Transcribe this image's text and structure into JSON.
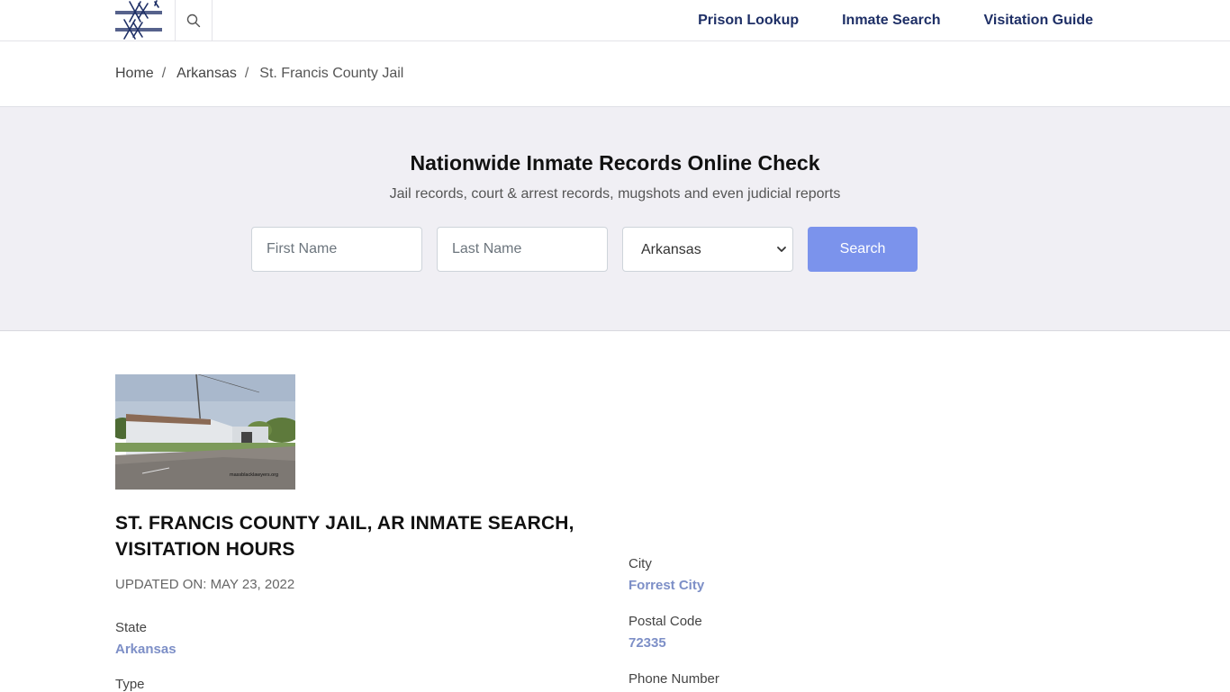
{
  "header": {
    "nav": [
      {
        "label": "Prison Lookup"
      },
      {
        "label": "Inmate Search"
      },
      {
        "label": "Visitation Guide"
      }
    ]
  },
  "breadcrumb": {
    "home": "Home",
    "state": "Arkansas",
    "current": "St. Francis County Jail",
    "separator": "/"
  },
  "hero": {
    "title": "Nationwide Inmate Records Online Check",
    "subtitle": "Jail records, court & arrest records, mugshots and even judicial reports",
    "first_name_placeholder": "First Name",
    "last_name_placeholder": "Last Name",
    "state_selected": "Arkansas",
    "search_label": "Search"
  },
  "facility": {
    "photo_watermark": "massblacklawyers.org",
    "title": "ST. FRANCIS COUNTY JAIL, AR INMATE SEARCH, VISITATION HOURS",
    "updated": "UPDATED ON: MAY 23, 2022",
    "state_label": "State",
    "state_value": "Arkansas",
    "type_label": "Type",
    "city_label": "City",
    "city_value": "Forrest City",
    "postal_label": "Postal Code",
    "postal_value": "72335",
    "phone_label": "Phone Number"
  },
  "colors": {
    "nav": "#1e2f66",
    "accent_button": "#7b93ec",
    "link_value": "#7d8fc7",
    "hero_bg": "#f0eff4"
  }
}
